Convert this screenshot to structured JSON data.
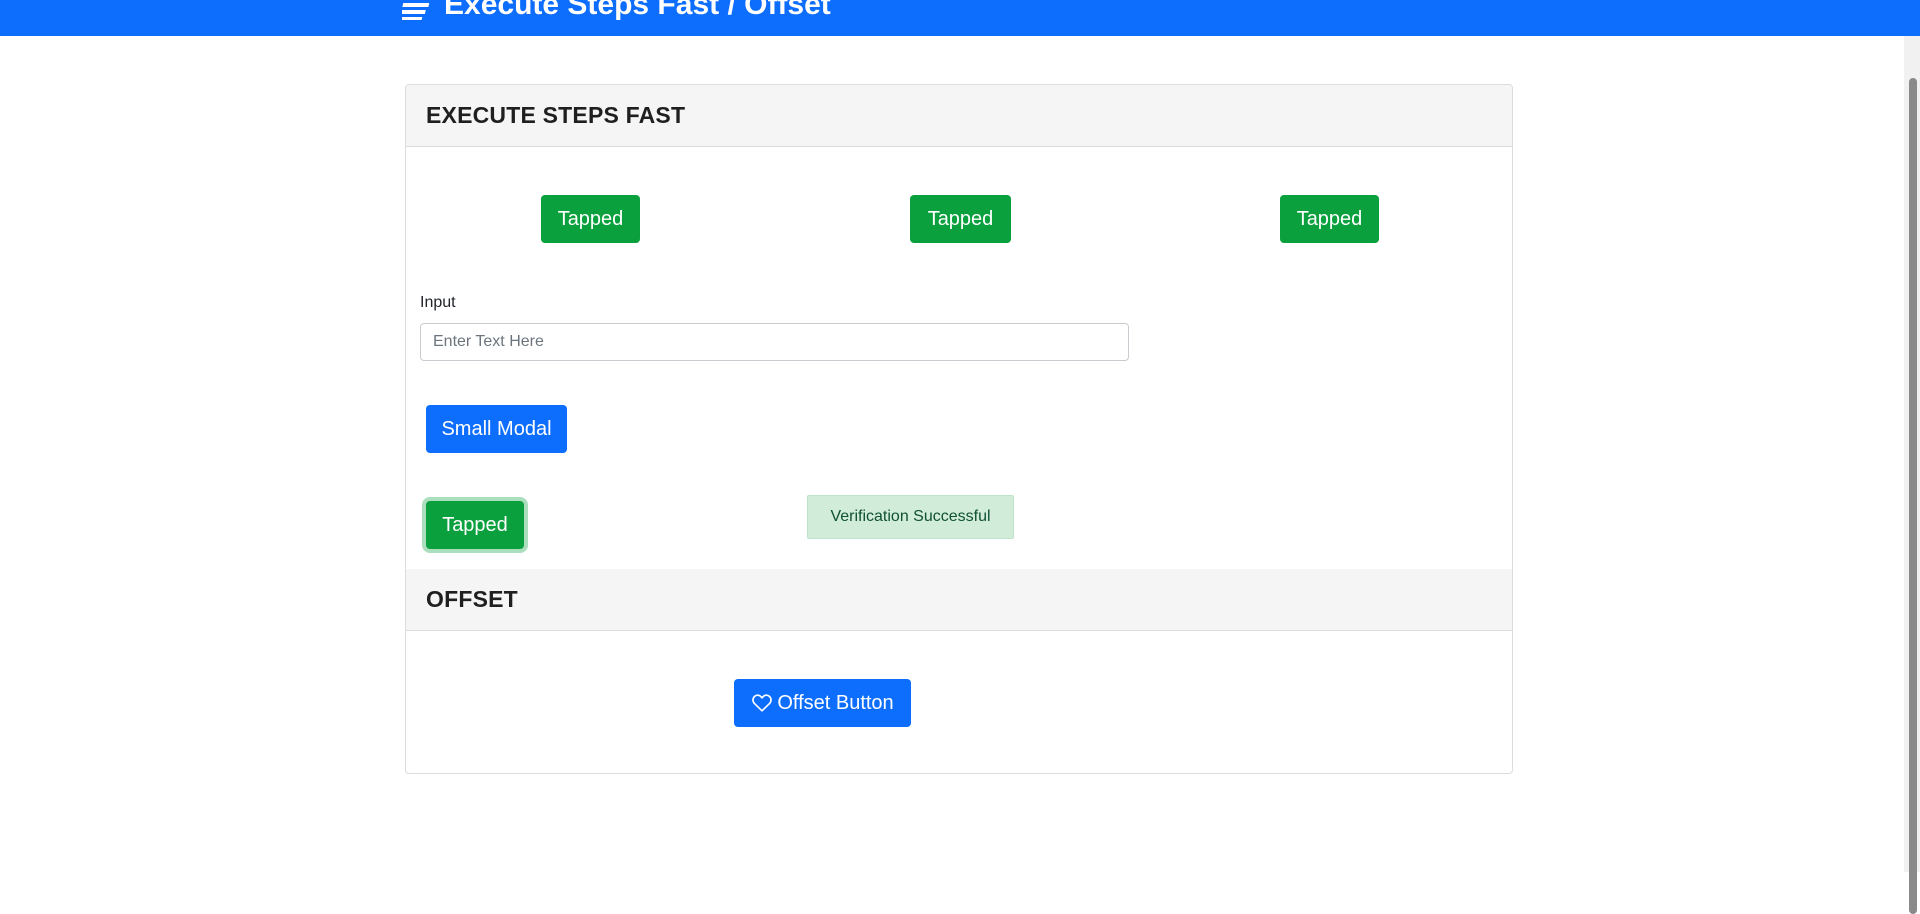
{
  "header": {
    "title": "Execute Steps Fast / Offset",
    "brand_color": "#0d6efd",
    "icon": "menu-stack-icon"
  },
  "execute_section": {
    "title": "EXECUTE STEPS FAST",
    "top_buttons": [
      "Tapped",
      "Tapped",
      "Tapped"
    ],
    "input_label": "Input",
    "input_placeholder": "Enter Text Here",
    "input_value": "",
    "small_modal_button": "Small Modal",
    "tapped_button": "Tapped",
    "verification_text": "Verification Successful"
  },
  "offset_section": {
    "title": "OFFSET",
    "offset_button": "Offset Button",
    "offset_button_icon": "heart-icon"
  },
  "colors": {
    "success": "#0ba03e",
    "primary": "#0d6efd",
    "alert_bg": "#d1ecd8"
  }
}
